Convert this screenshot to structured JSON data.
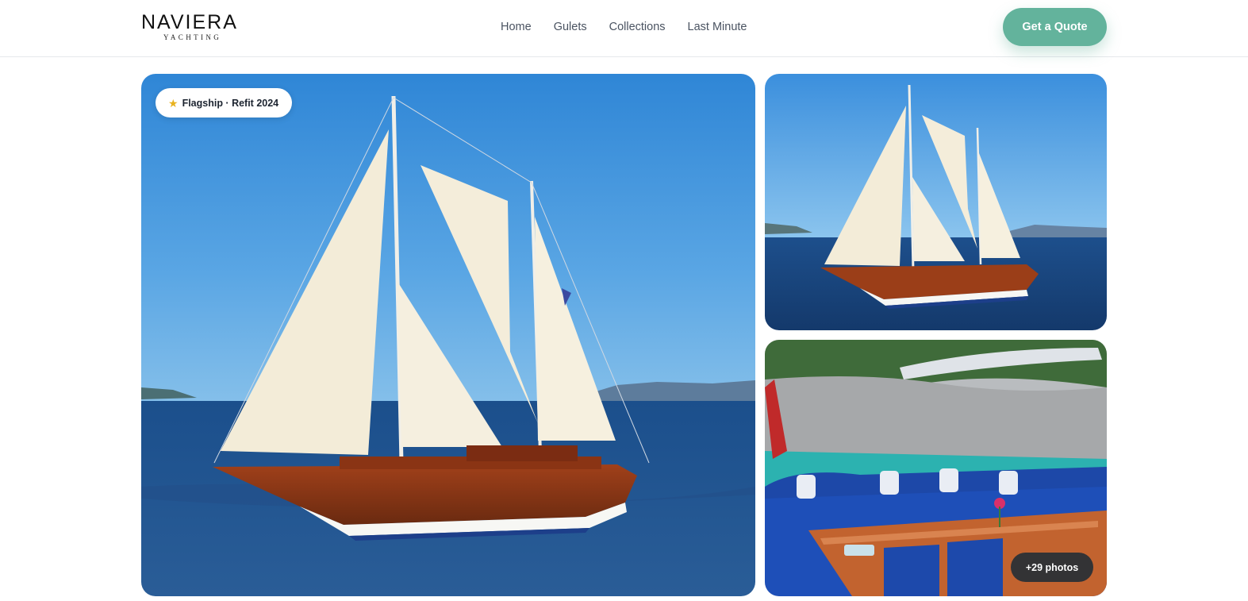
{
  "brand": {
    "name": "NAVIERA",
    "tagline": "YACHTING"
  },
  "nav": {
    "items": [
      {
        "label": "Home"
      },
      {
        "label": "Gulets"
      },
      {
        "label": "Collections"
      },
      {
        "label": "Last Minute"
      }
    ]
  },
  "header": {
    "cta_label": "Get a Quote"
  },
  "gallery": {
    "badge_label": "Flagship · Refit 2024",
    "badge_icon": "star-icon",
    "more_photos_label": "+29 photos"
  },
  "colors": {
    "accent": "#63b39c",
    "nav_text": "#4a5361",
    "photos_button_bg": "#142837"
  }
}
